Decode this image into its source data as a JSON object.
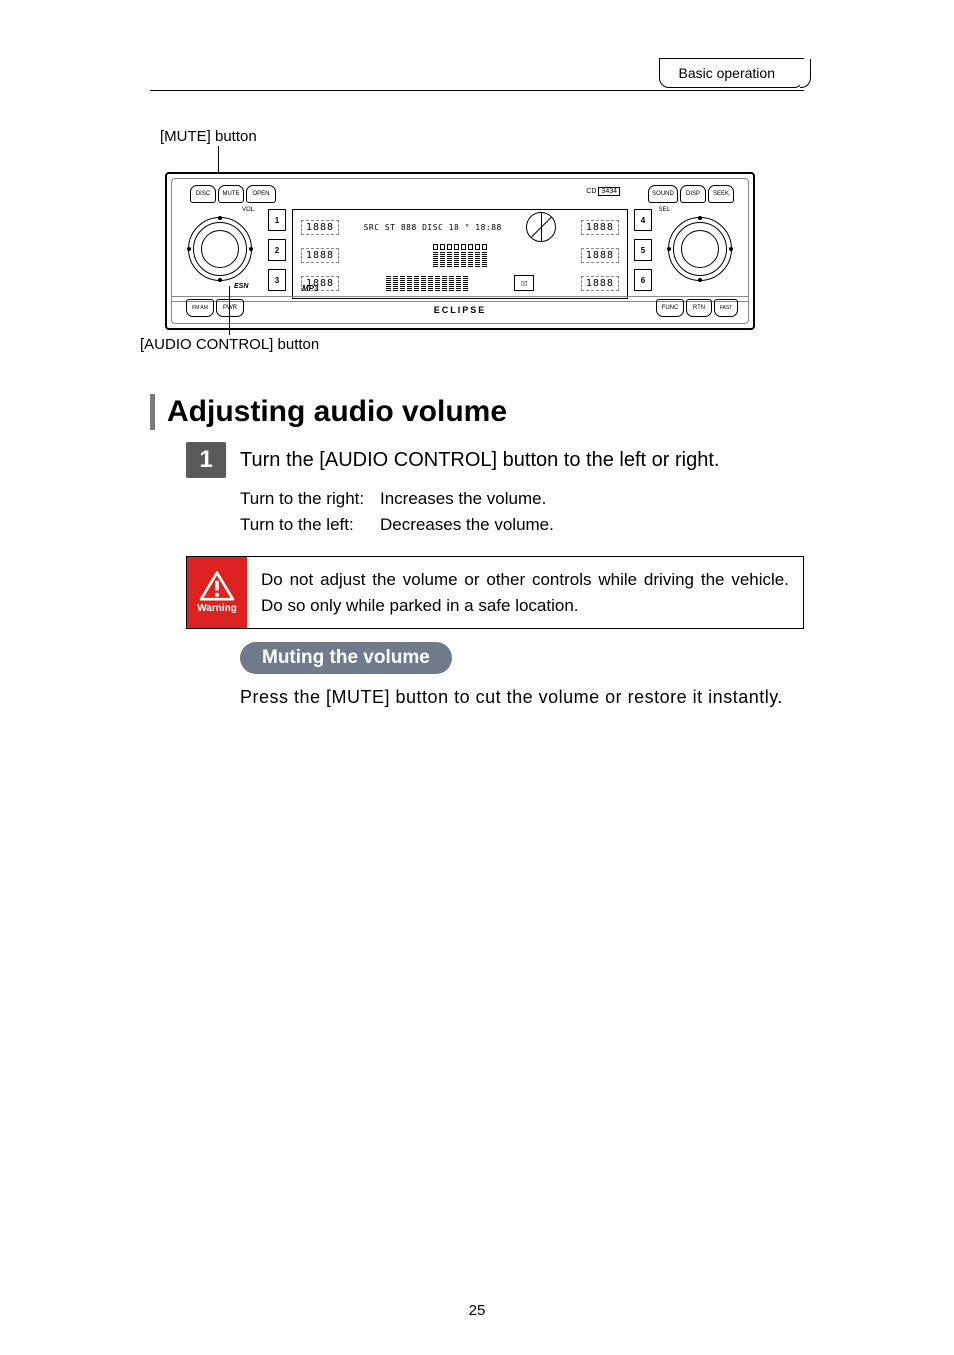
{
  "header": {
    "tab": "Basic operation"
  },
  "callouts": {
    "mute": "[MUTE] button",
    "audio": "[AUDIO CONTROL] button"
  },
  "radio": {
    "top_buttons": {
      "disc": "DISC",
      "mute": "MUTE",
      "open": "OPEN",
      "sound": "SOUND",
      "disp": "DISP",
      "seek": "SEEK"
    },
    "bottom_buttons": {
      "fmam": "FM\nAM",
      "pwr": "PWR",
      "func": "FUNC",
      "rtn": "RTN",
      "fast": "FAST"
    },
    "knob_labels": {
      "vol": "VOL",
      "esn": "ESN",
      "sel": "SEL"
    },
    "preset_left": [
      "1",
      "2",
      "3"
    ],
    "preset_right": [
      "4",
      "5",
      "6"
    ],
    "model_prefix": "CD",
    "model_num": "3434",
    "lcd": {
      "r1_left": "1888",
      "r1_mid": "SRC ST 888 DISC 18 ° 18:88",
      "r1_right": "1888",
      "r2_left": "1888",
      "r2_right": "1888",
      "r3_left": "1888",
      "r3_right": "1888"
    },
    "mp3": "MP3",
    "brand": "ECLIPSE"
  },
  "section": {
    "title": "Adjusting audio volume",
    "step_num": "1",
    "step_text": "Turn the [AUDIO CONTROL] button to the left or right.",
    "turns": [
      {
        "label": "Turn to the right:",
        "effect": "Increases the volume."
      },
      {
        "label": "Turn to the left:",
        "effect": "Decreases the volume."
      }
    ],
    "warning_label": "Warning",
    "warning_text": "Do not adjust the volume or other controls while driving the vehicle. Do so only while parked in a safe location.",
    "pill": "Muting the volume",
    "mute_text": "Press the [MUTE] button to cut the volume or restore it instantly."
  },
  "page_number": "25"
}
